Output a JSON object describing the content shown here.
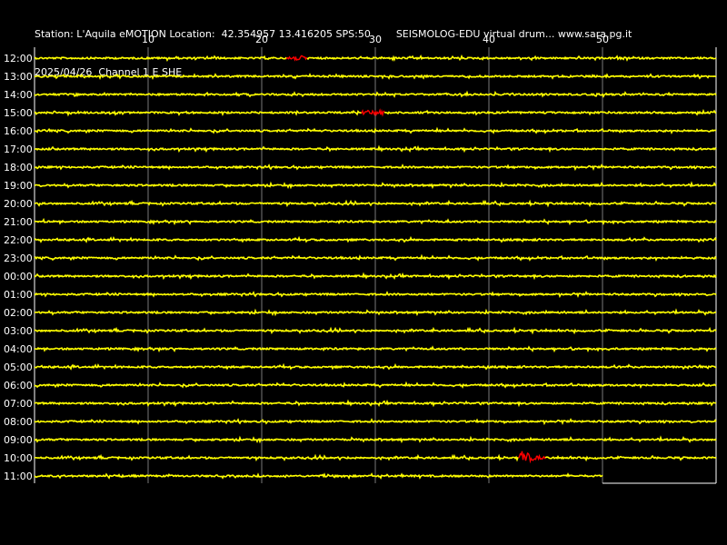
{
  "header": {
    "line1": "Station: L'Aquila eMOTION Location:  42.354957 13.416205 SPS:50        SEISMOLOG-EDU virtual drum... www.sara.pg.it",
    "line2": "2025/04/26  Channel 1 E SHE"
  },
  "colors": {
    "background": "#000000",
    "trace": "#ffff00",
    "event": "#ff0000",
    "grid": "#ffffff"
  },
  "chart_data": {
    "type": "line",
    "title": "",
    "xlabel": "",
    "ylabel": "",
    "xlim": [
      0,
      60
    ],
    "x_ticks": [
      10,
      20,
      30,
      40,
      50
    ],
    "x_tick_labels": [
      "10",
      "20",
      "30",
      "40",
      "50"
    ],
    "grid": true,
    "rows": [
      "12:00",
      "13:00",
      "14:00",
      "15:00",
      "16:00",
      "17:00",
      "18:00",
      "19:00",
      "20:00",
      "21:00",
      "22:00",
      "23:00",
      "00:00",
      "01:00",
      "02:00",
      "03:00",
      "04:00",
      "05:00",
      "06:00",
      "07:00",
      "08:00",
      "09:00",
      "10:00",
      "11:00"
    ],
    "last_row_end_minute": 50,
    "events": [
      {
        "row": "12:00",
        "start_minute": 22.2,
        "end_minute": 24.0
      },
      {
        "row": "15:00",
        "start_minute": 28.8,
        "end_minute": 30.8
      },
      {
        "row": "10:00",
        "start_minute": 42.6,
        "end_minute": 45.0
      }
    ]
  }
}
